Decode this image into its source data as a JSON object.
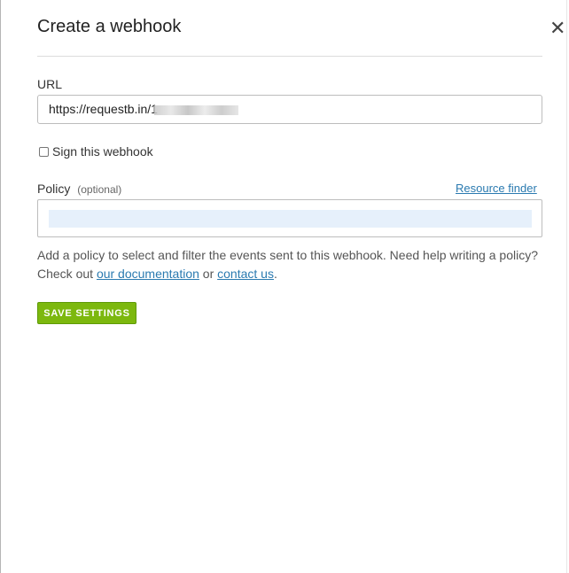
{
  "dialog": {
    "title": "Create a webhook",
    "close_glyph": "✕"
  },
  "url_field": {
    "label": "URL",
    "value": "https://requestb.in/1"
  },
  "sign": {
    "label": "Sign this webhook",
    "checked": false
  },
  "policy": {
    "label": "Policy",
    "optional_label": "(optional)",
    "resource_finder_link": "Resource finder",
    "value": ""
  },
  "help": {
    "text_1": "Add a policy to select and filter the events sent to this webhook. Need help writing a policy? Check out ",
    "docs_link": "our documentation",
    "text_2": " or ",
    "contact_link": "contact us",
    "text_3": "."
  },
  "actions": {
    "save_label": "SAVE SETTINGS"
  },
  "colors": {
    "save_button": "#7cb80e",
    "link": "#2a7ab0",
    "editor_highlight": "#e6f0fb"
  }
}
